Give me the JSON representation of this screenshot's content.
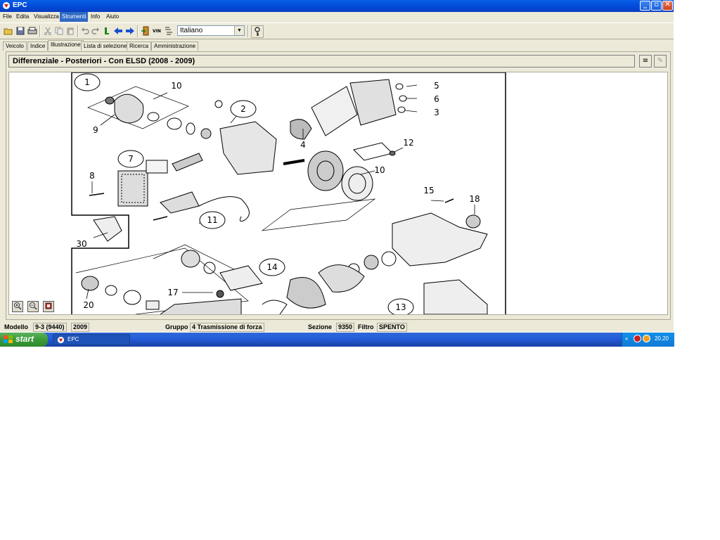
{
  "window": {
    "title": "EPC"
  },
  "menu": [
    "File",
    "Edita",
    "Visualizza",
    "Strumenti",
    "Info",
    "Aiuto"
  ],
  "toolbar": {
    "language": "Italiano",
    "vin_label": "VIN"
  },
  "tabs": [
    "Veicolo",
    "Indice",
    "Illustrazione",
    "Lista di selezione",
    "Ricerca",
    "Amministrazione"
  ],
  "header": {
    "title": "Differenziale - Posteriori - Con ELSD   (2008 - 2009)"
  },
  "diagram": {
    "callouts": [
      "1",
      "10",
      "9",
      "2",
      "5",
      "6",
      "3",
      "4",
      "12",
      "10",
      "7",
      "8",
      "11",
      "15",
      "18",
      "30",
      "14",
      "20",
      "17",
      "13"
    ]
  },
  "status": {
    "modello_label": "Modello",
    "modello_value": "9-3 (9440)",
    "year_value": "2009",
    "gruppo_label": "Gruppo",
    "gruppo_value": "4 Trasmissione di forza",
    "sezione_label": "Sezione",
    "sezione_value": "9350",
    "filtro_label": "Filtro",
    "filtro_value": "SPENTO"
  },
  "taskbar": {
    "start_label": "start",
    "task_label": "EPC",
    "clock": "20.20"
  },
  "colors": {
    "titlebar": "#0048d6",
    "menu_highlight": "#316ac5",
    "taskbar": "#245edb",
    "start": "#3a9a3a"
  }
}
